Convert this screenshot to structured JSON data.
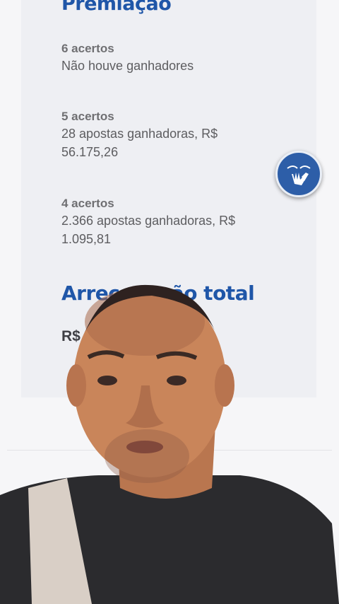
{
  "premiacao": {
    "title": "Premiação",
    "tiers": [
      {
        "label": "6 acertos",
        "line1": "Não houve ganhadores",
        "line2": ""
      },
      {
        "label": "5 acertos",
        "line1": "28 apostas ganhadoras, R$",
        "line2": "56.175,26"
      },
      {
        "label": "4 acertos",
        "line1": "2.366 apostas ganhadoras, R$",
        "line2": "1.095,81"
      }
    ]
  },
  "arrecadacao": {
    "title": "Arrecadação total",
    "value": "R$"
  },
  "accessibility_button": {
    "icon": "sign-language-hands-icon",
    "color": "#2d5ea8"
  },
  "colors": {
    "title_blue": "#1f56a8",
    "card_bg": "#eeeff3",
    "page_bg": "#f6f6f8"
  }
}
